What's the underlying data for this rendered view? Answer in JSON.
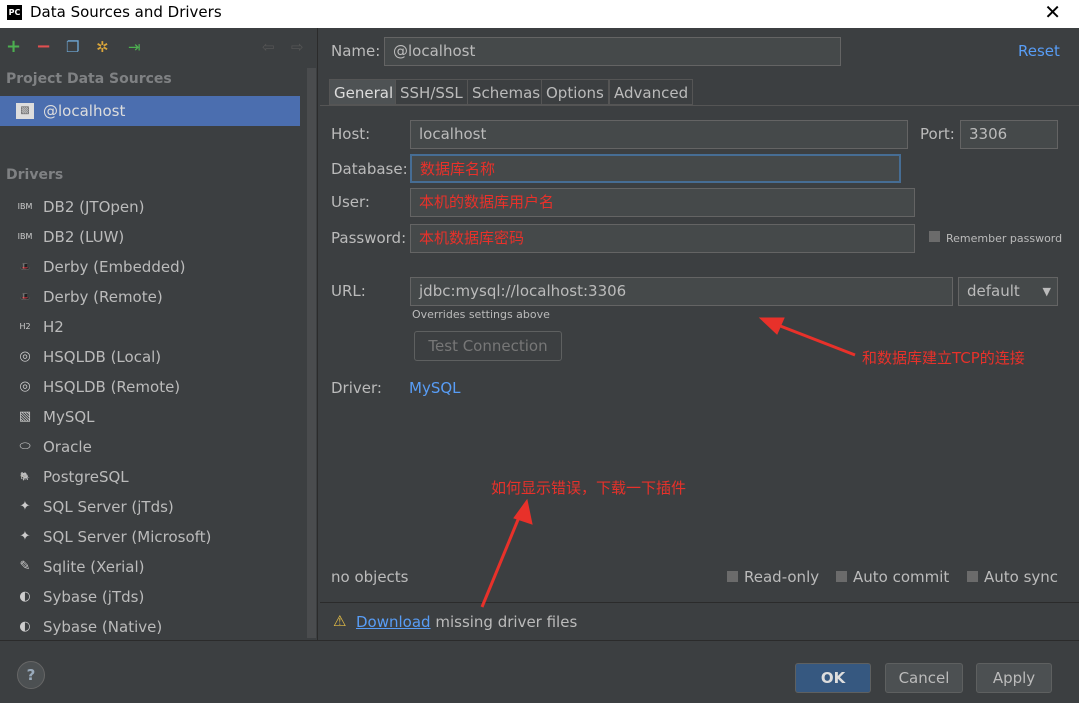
{
  "window": {
    "title": "Data Sources and Drivers",
    "close": "✕"
  },
  "sidebar": {
    "section_project": "Project Data Sources",
    "selected": "@localhost",
    "section_drivers": "Drivers",
    "drivers": [
      {
        "label": "DB2 (JTOpen)",
        "icon": "ibm-db2-icon",
        "glyph": "IBM"
      },
      {
        "label": "DB2 (LUW)",
        "icon": "ibm-db2-icon",
        "glyph": "IBM"
      },
      {
        "label": "Derby (Embedded)",
        "icon": "derby-icon",
        "glyph": "🎩"
      },
      {
        "label": "Derby (Remote)",
        "icon": "derby-icon",
        "glyph": "🎩"
      },
      {
        "label": "H2",
        "icon": "h2-icon",
        "glyph": "H2"
      },
      {
        "label": "HSQLDB (Local)",
        "icon": "hsqldb-icon",
        "glyph": "◎"
      },
      {
        "label": "HSQLDB (Remote)",
        "icon": "hsqldb-icon",
        "glyph": "◎"
      },
      {
        "label": "MySQL",
        "icon": "mysql-icon",
        "glyph": "▧"
      },
      {
        "label": "Oracle",
        "icon": "oracle-icon",
        "glyph": "⬭"
      },
      {
        "label": "PostgreSQL",
        "icon": "postgresql-icon",
        "glyph": "🐘"
      },
      {
        "label": "SQL Server (jTds)",
        "icon": "sqlserver-icon",
        "glyph": "✦"
      },
      {
        "label": "SQL Server (Microsoft)",
        "icon": "sqlserver-icon",
        "glyph": "✦"
      },
      {
        "label": "Sqlite (Xerial)",
        "icon": "sqlite-icon",
        "glyph": "✎"
      },
      {
        "label": "Sybase (jTds)",
        "icon": "sybase-icon",
        "glyph": "◐"
      },
      {
        "label": "Sybase (Native)",
        "icon": "sybase-icon",
        "glyph": "◐"
      }
    ]
  },
  "form": {
    "name_label": "Name:",
    "name": "@localhost",
    "reset": "Reset",
    "tabs": [
      "General",
      "SSH/SSL",
      "Schemas",
      "Options",
      "Advanced"
    ],
    "host_label": "Host:",
    "host": "localhost",
    "port_label": "Port:",
    "port": "3306",
    "database_label": "Database:",
    "database": "数据库名称",
    "user_label": "User:",
    "user": "本机的数据库用户名",
    "password_label": "Password:",
    "password": "本机数据库密码",
    "remember": "Remember password",
    "url_label": "URL:",
    "url": "jdbc:mysql://localhost:3306",
    "url_mode": "default",
    "url_hint": "Overrides settings above",
    "test": "Test Connection",
    "driver_label": "Driver:",
    "driver": "MySQL",
    "status": "no objects",
    "readonly": "Read-only",
    "autocommit": "Auto commit",
    "autosync": "Auto sync",
    "download": "Download",
    "download_rest": "missing driver files"
  },
  "annotations": {
    "tcp": "和数据库建立TCP的连接",
    "error": "如何显示错误，下载一下插件"
  },
  "footer": {
    "help": "?",
    "ok": "OK",
    "cancel": "Cancel",
    "apply": "Apply"
  }
}
